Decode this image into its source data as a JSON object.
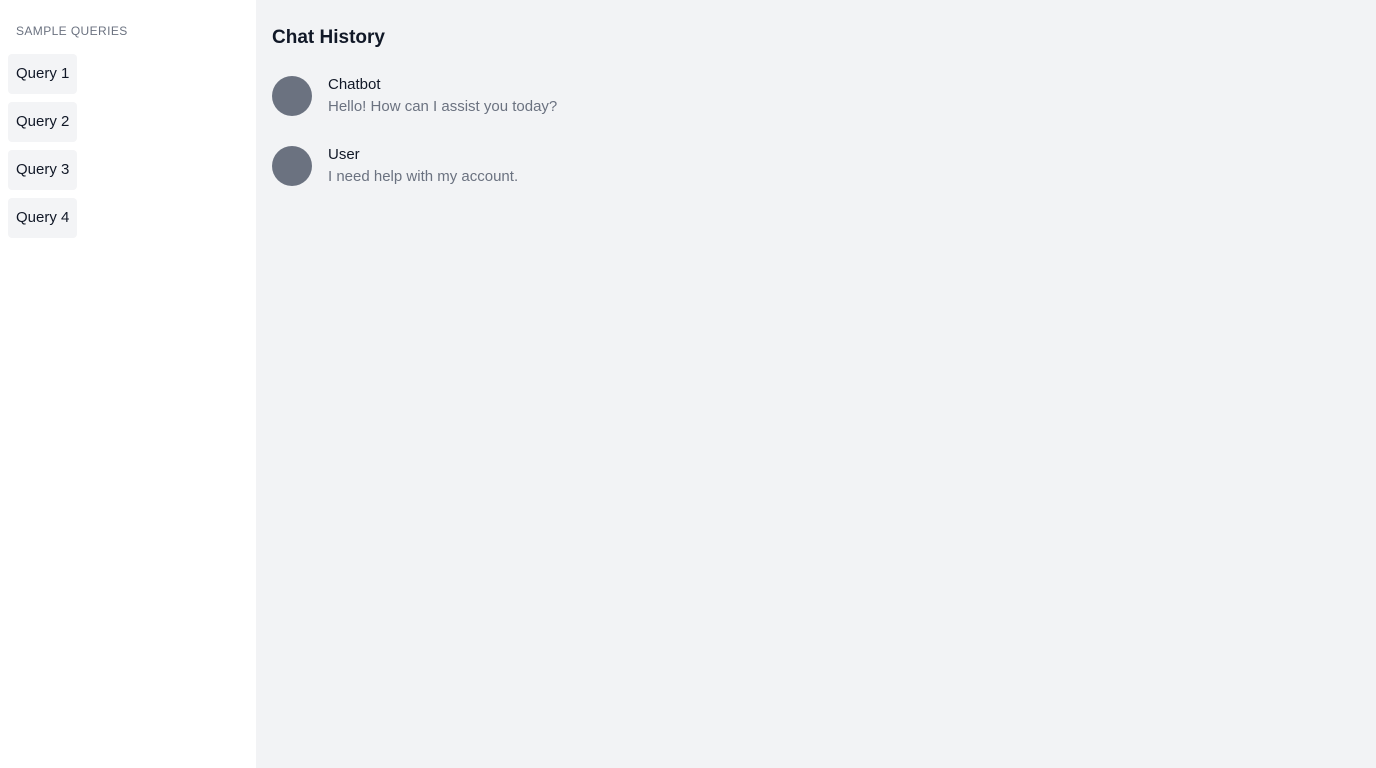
{
  "sidebar": {
    "heading": "SAMPLE QUERIES",
    "queries": [
      {
        "label": "Query 1"
      },
      {
        "label": "Query 2"
      },
      {
        "label": "Query 3"
      },
      {
        "label": "Query 4"
      }
    ]
  },
  "main": {
    "title": "Chat History",
    "messages": [
      {
        "sender": "Chatbot",
        "text": "Hello! How can I assist you today?"
      },
      {
        "sender": "User",
        "text": "I need help with my account."
      }
    ]
  },
  "colors": {
    "sidebar_bg": "#ffffff",
    "main_bg": "#f2f3f5",
    "button_bg": "#f3f4f6",
    "avatar": "#6b7280",
    "muted_text": "#6b7280",
    "primary_text": "#111827"
  }
}
